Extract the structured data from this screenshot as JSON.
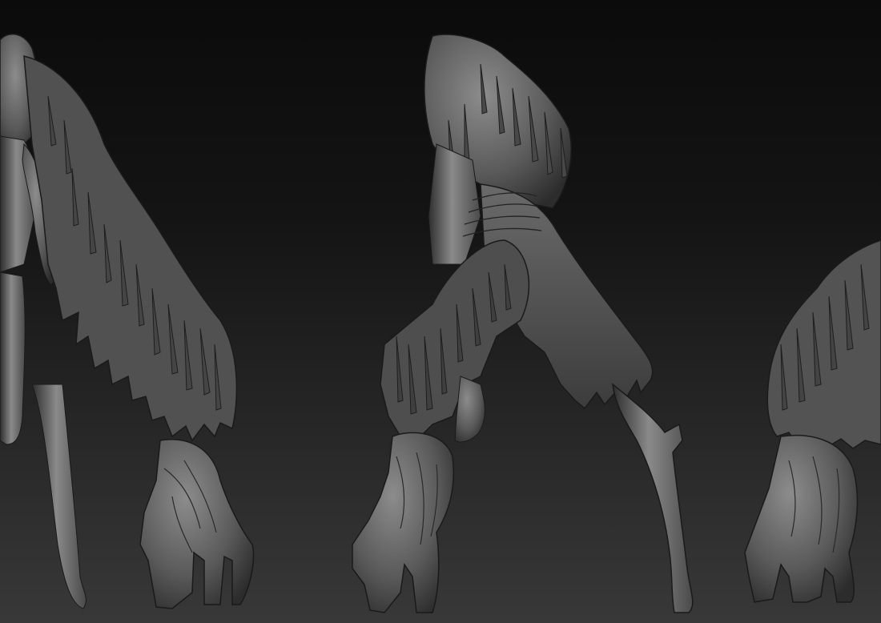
{
  "scene": {
    "background_top": "#0b0b0b",
    "background_bottom": "#383838",
    "clay_light": "#8a8a8a",
    "clay_mid": "#5e5e5e",
    "clay_dark": "#2e2e2e",
    "clay_edge": "#1a1a1a"
  },
  "figures": [
    {
      "view": "front-left"
    },
    {
      "view": "side"
    },
    {
      "view": "back-right"
    }
  ]
}
